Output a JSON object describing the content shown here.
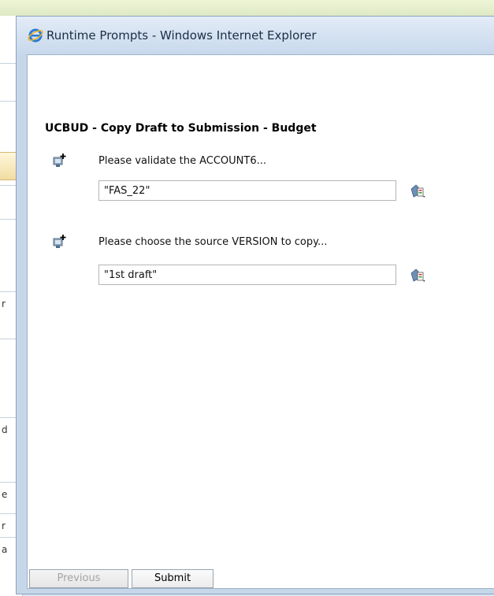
{
  "window": {
    "title": "Runtime Prompts - Windows Internet Explorer"
  },
  "form": {
    "heading": "UCBUD - Copy Draft to Submission - Budget",
    "prompts": [
      {
        "label": "Please validate the ACCOUNT6...",
        "value": "\"FAS_22\""
      },
      {
        "label": "Please choose the source VERSION to copy...",
        "value": "\"1st draft\""
      }
    ]
  },
  "buttons": {
    "previous": "Previous",
    "submit": "Submit"
  },
  "background_fragments": [
    "r",
    "d",
    "e",
    "r",
    "a"
  ],
  "icons": {
    "title": "ie-logo-icon",
    "prompt": "prompt-member-icon",
    "member_select": "member-selector-icon"
  },
  "colors": {
    "title_text": "#1b2d47",
    "window_frame": "#c7d7ea",
    "disabled_text": "#a4a4a4"
  }
}
